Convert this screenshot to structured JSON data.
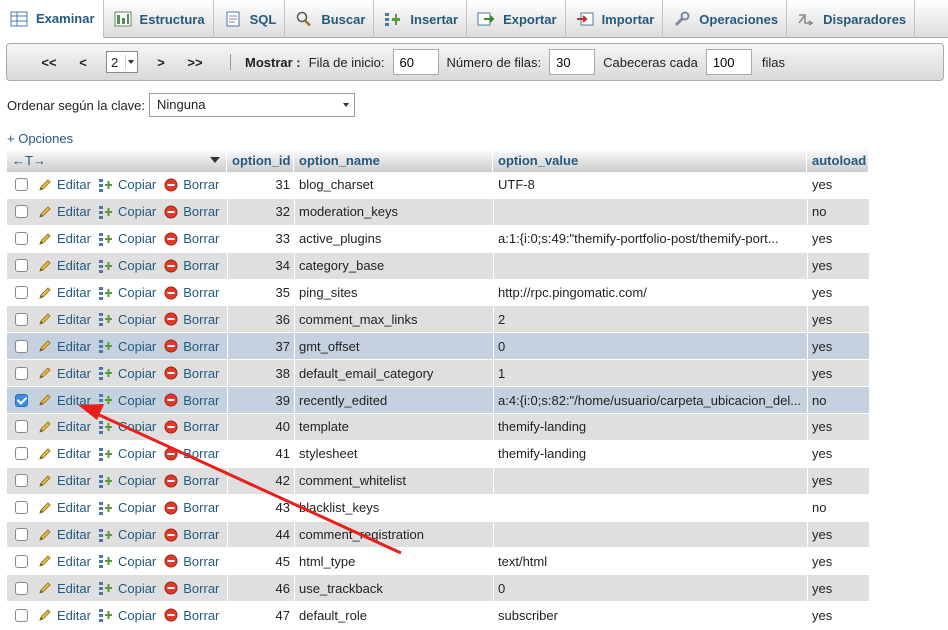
{
  "tabs": [
    {
      "label": "Examinar",
      "icon": "browse-icon",
      "active": true
    },
    {
      "label": "Estructura",
      "icon": "structure-icon"
    },
    {
      "label": "SQL",
      "icon": "sql-icon"
    },
    {
      "label": "Buscar",
      "icon": "search-icon"
    },
    {
      "label": "Insertar",
      "icon": "insert-icon"
    },
    {
      "label": "Exportar",
      "icon": "export-icon"
    },
    {
      "label": "Importar",
      "icon": "import-icon"
    },
    {
      "label": "Operaciones",
      "icon": "wrench-icon"
    },
    {
      "label": "Disparadores",
      "icon": "triggers-icon"
    }
  ],
  "nav": {
    "first": "<<",
    "prev": "<",
    "page": "2",
    "next": ">",
    "last": ">>",
    "show_label": "Mostrar :",
    "start_label": "Fila de inicio:",
    "start_value": "60",
    "rows_label": "Número de filas:",
    "rows_value": "30",
    "headers_label": "Cabeceras cada",
    "headers_value": "100",
    "rows_suffix": "filas"
  },
  "sort": {
    "label": "Ordenar según la clave:",
    "value": "Ninguna"
  },
  "options_link": "+ Opciones",
  "table": {
    "resize_glyph": "←T→",
    "columns": [
      "option_id",
      "option_name",
      "option_value",
      "autoload"
    ],
    "action_labels": {
      "edit": "Editar",
      "copy": "Copiar",
      "delete": "Borrar"
    },
    "rows": [
      {
        "id": "31",
        "name": "blog_charset",
        "value": "UTF-8",
        "autoload": "yes",
        "checked": false
      },
      {
        "id": "32",
        "name": "moderation_keys",
        "value": "",
        "autoload": "no",
        "checked": false
      },
      {
        "id": "33",
        "name": "active_plugins",
        "value": "a:1:{i:0;s:49:\"themify-portfolio-post/themify-port...",
        "autoload": "yes",
        "checked": false
      },
      {
        "id": "34",
        "name": "category_base",
        "value": "",
        "autoload": "yes",
        "checked": false
      },
      {
        "id": "35",
        "name": "ping_sites",
        "value": "http://rpc.pingomatic.com/",
        "autoload": "yes",
        "checked": false
      },
      {
        "id": "36",
        "name": "comment_max_links",
        "value": "2",
        "autoload": "yes",
        "checked": false
      },
      {
        "id": "37",
        "name": "gmt_offset",
        "value": "0",
        "autoload": "yes",
        "checked": false
      },
      {
        "id": "38",
        "name": "default_email_category",
        "value": "1",
        "autoload": "yes",
        "checked": false
      },
      {
        "id": "39",
        "name": "recently_edited",
        "value": "a:4:{i:0;s:82:\"/home/usuario/carpeta_ubicacion_del...",
        "autoload": "no",
        "checked": true
      },
      {
        "id": "40",
        "name": "template",
        "value": "themify-landing",
        "autoload": "yes",
        "checked": false
      },
      {
        "id": "41",
        "name": "stylesheet",
        "value": "themify-landing",
        "autoload": "yes",
        "checked": false
      },
      {
        "id": "42",
        "name": "comment_whitelist",
        "value": "",
        "autoload": "yes",
        "checked": false
      },
      {
        "id": "43",
        "name": "blacklist_keys",
        "value": "",
        "autoload": "no",
        "checked": false
      },
      {
        "id": "44",
        "name": "comment_registration",
        "value": "",
        "autoload": "yes",
        "checked": false
      },
      {
        "id": "45",
        "name": "html_type",
        "value": "text/html",
        "autoload": "yes",
        "checked": false
      },
      {
        "id": "46",
        "name": "use_trackback",
        "value": "0",
        "autoload": "yes",
        "checked": false
      },
      {
        "id": "47",
        "name": "default_role",
        "value": "subscriber",
        "autoload": "yes",
        "checked": false
      }
    ]
  },
  "colors": {
    "link": "#235a81",
    "marked_row": "#c5d1de",
    "even_row": "#dfdfdf",
    "annotation_arrow": "#e8201c"
  }
}
